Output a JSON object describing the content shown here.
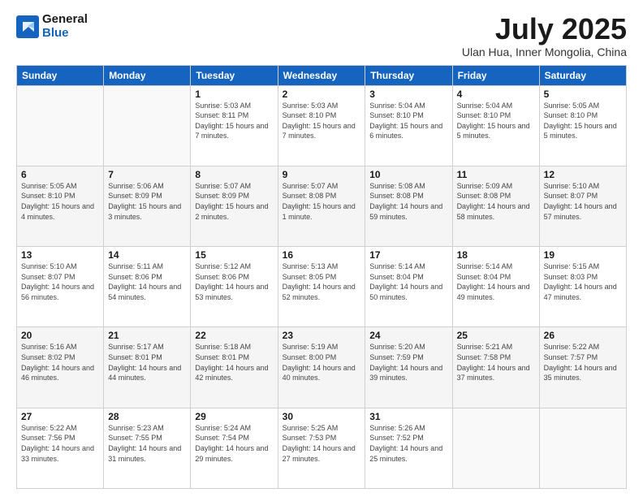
{
  "logo": {
    "general": "General",
    "blue": "Blue"
  },
  "title": {
    "month_year": "July 2025",
    "location": "Ulan Hua, Inner Mongolia, China"
  },
  "weekdays": [
    "Sunday",
    "Monday",
    "Tuesday",
    "Wednesday",
    "Thursday",
    "Friday",
    "Saturday"
  ],
  "weeks": [
    [
      {
        "day": "",
        "sunrise": "",
        "sunset": "",
        "daylight": ""
      },
      {
        "day": "",
        "sunrise": "",
        "sunset": "",
        "daylight": ""
      },
      {
        "day": "1",
        "sunrise": "Sunrise: 5:03 AM",
        "sunset": "Sunset: 8:11 PM",
        "daylight": "Daylight: 15 hours and 7 minutes."
      },
      {
        "day": "2",
        "sunrise": "Sunrise: 5:03 AM",
        "sunset": "Sunset: 8:10 PM",
        "daylight": "Daylight: 15 hours and 7 minutes."
      },
      {
        "day": "3",
        "sunrise": "Sunrise: 5:04 AM",
        "sunset": "Sunset: 8:10 PM",
        "daylight": "Daylight: 15 hours and 6 minutes."
      },
      {
        "day": "4",
        "sunrise": "Sunrise: 5:04 AM",
        "sunset": "Sunset: 8:10 PM",
        "daylight": "Daylight: 15 hours and 5 minutes."
      },
      {
        "day": "5",
        "sunrise": "Sunrise: 5:05 AM",
        "sunset": "Sunset: 8:10 PM",
        "daylight": "Daylight: 15 hours and 5 minutes."
      }
    ],
    [
      {
        "day": "6",
        "sunrise": "Sunrise: 5:05 AM",
        "sunset": "Sunset: 8:10 PM",
        "daylight": "Daylight: 15 hours and 4 minutes."
      },
      {
        "day": "7",
        "sunrise": "Sunrise: 5:06 AM",
        "sunset": "Sunset: 8:09 PM",
        "daylight": "Daylight: 15 hours and 3 minutes."
      },
      {
        "day": "8",
        "sunrise": "Sunrise: 5:07 AM",
        "sunset": "Sunset: 8:09 PM",
        "daylight": "Daylight: 15 hours and 2 minutes."
      },
      {
        "day": "9",
        "sunrise": "Sunrise: 5:07 AM",
        "sunset": "Sunset: 8:08 PM",
        "daylight": "Daylight: 15 hours and 1 minute."
      },
      {
        "day": "10",
        "sunrise": "Sunrise: 5:08 AM",
        "sunset": "Sunset: 8:08 PM",
        "daylight": "Daylight: 14 hours and 59 minutes."
      },
      {
        "day": "11",
        "sunrise": "Sunrise: 5:09 AM",
        "sunset": "Sunset: 8:08 PM",
        "daylight": "Daylight: 14 hours and 58 minutes."
      },
      {
        "day": "12",
        "sunrise": "Sunrise: 5:10 AM",
        "sunset": "Sunset: 8:07 PM",
        "daylight": "Daylight: 14 hours and 57 minutes."
      }
    ],
    [
      {
        "day": "13",
        "sunrise": "Sunrise: 5:10 AM",
        "sunset": "Sunset: 8:07 PM",
        "daylight": "Daylight: 14 hours and 56 minutes."
      },
      {
        "day": "14",
        "sunrise": "Sunrise: 5:11 AM",
        "sunset": "Sunset: 8:06 PM",
        "daylight": "Daylight: 14 hours and 54 minutes."
      },
      {
        "day": "15",
        "sunrise": "Sunrise: 5:12 AM",
        "sunset": "Sunset: 8:06 PM",
        "daylight": "Daylight: 14 hours and 53 minutes."
      },
      {
        "day": "16",
        "sunrise": "Sunrise: 5:13 AM",
        "sunset": "Sunset: 8:05 PM",
        "daylight": "Daylight: 14 hours and 52 minutes."
      },
      {
        "day": "17",
        "sunrise": "Sunrise: 5:14 AM",
        "sunset": "Sunset: 8:04 PM",
        "daylight": "Daylight: 14 hours and 50 minutes."
      },
      {
        "day": "18",
        "sunrise": "Sunrise: 5:14 AM",
        "sunset": "Sunset: 8:04 PM",
        "daylight": "Daylight: 14 hours and 49 minutes."
      },
      {
        "day": "19",
        "sunrise": "Sunrise: 5:15 AM",
        "sunset": "Sunset: 8:03 PM",
        "daylight": "Daylight: 14 hours and 47 minutes."
      }
    ],
    [
      {
        "day": "20",
        "sunrise": "Sunrise: 5:16 AM",
        "sunset": "Sunset: 8:02 PM",
        "daylight": "Daylight: 14 hours and 46 minutes."
      },
      {
        "day": "21",
        "sunrise": "Sunrise: 5:17 AM",
        "sunset": "Sunset: 8:01 PM",
        "daylight": "Daylight: 14 hours and 44 minutes."
      },
      {
        "day": "22",
        "sunrise": "Sunrise: 5:18 AM",
        "sunset": "Sunset: 8:01 PM",
        "daylight": "Daylight: 14 hours and 42 minutes."
      },
      {
        "day": "23",
        "sunrise": "Sunrise: 5:19 AM",
        "sunset": "Sunset: 8:00 PM",
        "daylight": "Daylight: 14 hours and 40 minutes."
      },
      {
        "day": "24",
        "sunrise": "Sunrise: 5:20 AM",
        "sunset": "Sunset: 7:59 PM",
        "daylight": "Daylight: 14 hours and 39 minutes."
      },
      {
        "day": "25",
        "sunrise": "Sunrise: 5:21 AM",
        "sunset": "Sunset: 7:58 PM",
        "daylight": "Daylight: 14 hours and 37 minutes."
      },
      {
        "day": "26",
        "sunrise": "Sunrise: 5:22 AM",
        "sunset": "Sunset: 7:57 PM",
        "daylight": "Daylight: 14 hours and 35 minutes."
      }
    ],
    [
      {
        "day": "27",
        "sunrise": "Sunrise: 5:22 AM",
        "sunset": "Sunset: 7:56 PM",
        "daylight": "Daylight: 14 hours and 33 minutes."
      },
      {
        "day": "28",
        "sunrise": "Sunrise: 5:23 AM",
        "sunset": "Sunset: 7:55 PM",
        "daylight": "Daylight: 14 hours and 31 minutes."
      },
      {
        "day": "29",
        "sunrise": "Sunrise: 5:24 AM",
        "sunset": "Sunset: 7:54 PM",
        "daylight": "Daylight: 14 hours and 29 minutes."
      },
      {
        "day": "30",
        "sunrise": "Sunrise: 5:25 AM",
        "sunset": "Sunset: 7:53 PM",
        "daylight": "Daylight: 14 hours and 27 minutes."
      },
      {
        "day": "31",
        "sunrise": "Sunrise: 5:26 AM",
        "sunset": "Sunset: 7:52 PM",
        "daylight": "Daylight: 14 hours and 25 minutes."
      },
      {
        "day": "",
        "sunrise": "",
        "sunset": "",
        "daylight": ""
      },
      {
        "day": "",
        "sunrise": "",
        "sunset": "",
        "daylight": ""
      }
    ]
  ]
}
